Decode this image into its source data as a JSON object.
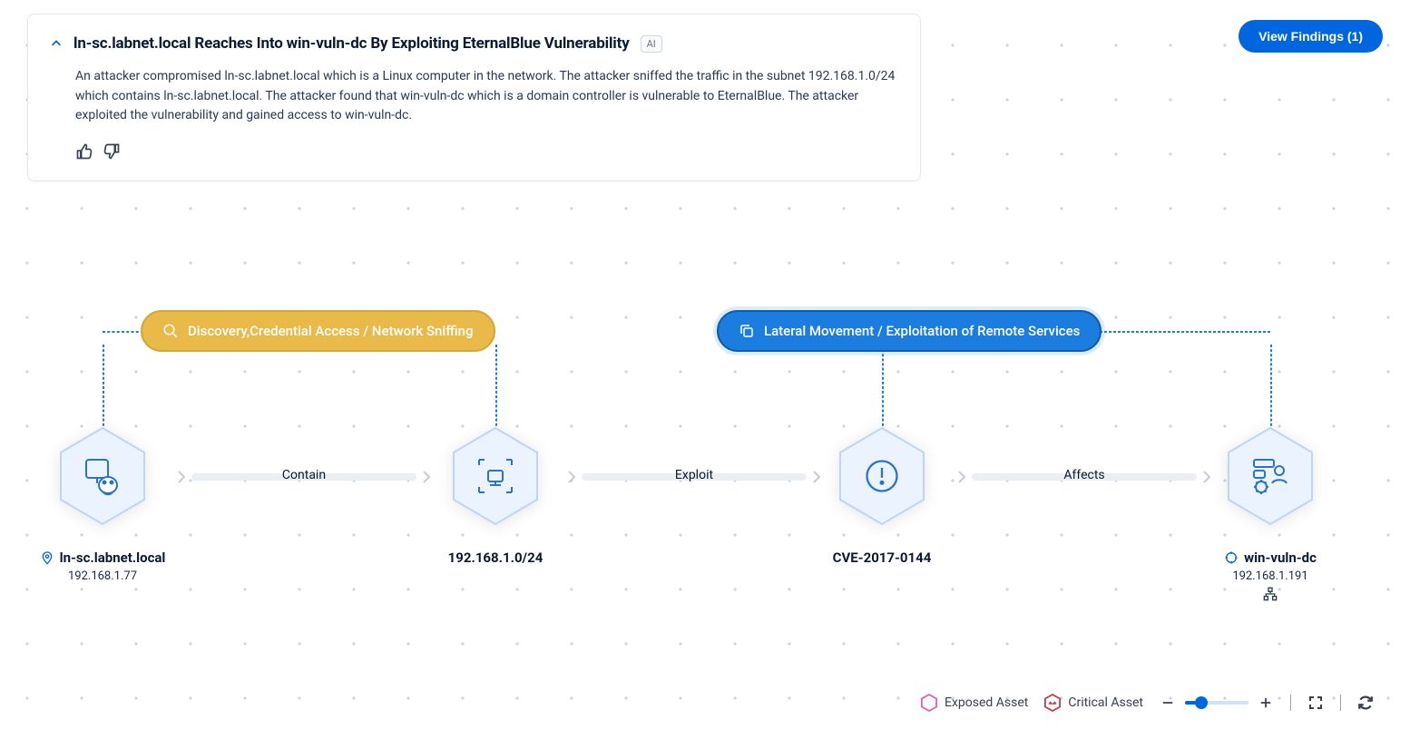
{
  "button_view_findings": "View Findings (1)",
  "card": {
    "title": "ln-sc.labnet.local Reaches Into win-vuln-dc By Exploiting EternalBlue Vulnerability",
    "ai_badge": "AI",
    "body": "An attacker compromised ln-sc.labnet.local which is a Linux computer in the network. The attacker sniffed the traffic in the subnet 192.168.1.0/24 which contains ln-sc.labnet.local. The attacker found that win-vuln-dc which is a domain controller is vulnerable to EternalBlue. The attacker exploited the vulnerability and gained access to win-vuln-dc."
  },
  "tactics": {
    "discovery": "Discovery,Credential Access / Network Sniffing",
    "lateral": "Lateral Movement / Exploitation of Remote Services"
  },
  "edges": {
    "contain": "Contain",
    "exploit": "Exploit",
    "affects": "Affects"
  },
  "nodes": {
    "n1_title": "ln-sc.labnet.local",
    "n1_sub": "192.168.1.77",
    "n2_title": "192.168.1.0/24",
    "n3_title": "CVE-2017-0144",
    "n4_title": "win-vuln-dc",
    "n4_sub": "192.168.1.191"
  },
  "legend": {
    "exposed": "Exposed Asset",
    "critical": "Critical Asset"
  }
}
